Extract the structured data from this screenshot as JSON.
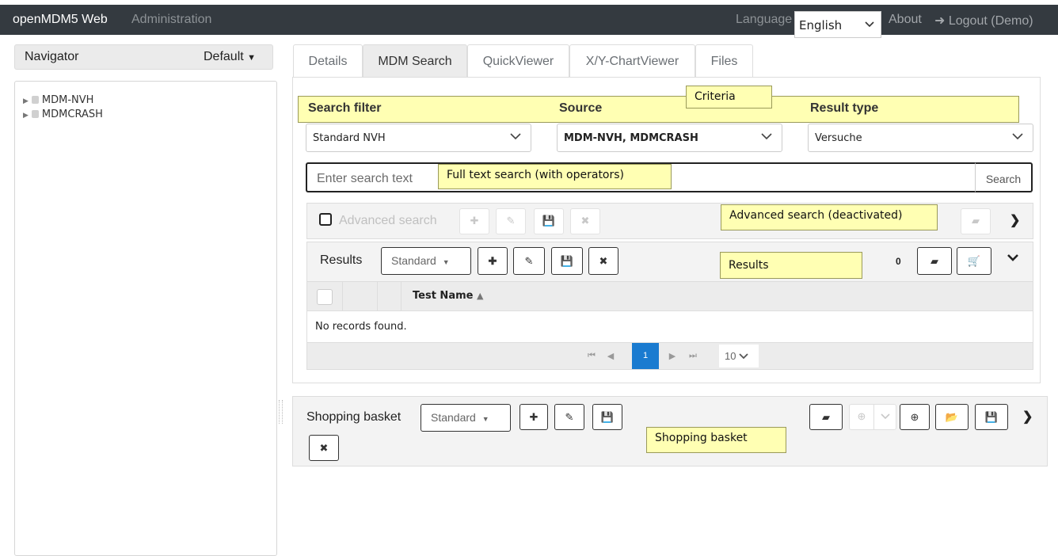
{
  "header": {
    "brand": "openMDM5 Web",
    "admin_link": "Administration",
    "language_label": "Language",
    "language_value": "English",
    "about": "About",
    "logout": "Logout (Demo)"
  },
  "navigator": {
    "title": "Navigator",
    "view_selector": "Default",
    "tree": [
      {
        "label": "MDM-NVH"
      },
      {
        "label": "MDMCRASH"
      }
    ]
  },
  "tabs": [
    {
      "label": "Details",
      "active": false
    },
    {
      "label": "MDM Search",
      "active": true
    },
    {
      "label": "QuickViewer",
      "active": false
    },
    {
      "label": "X/Y-ChartViewer",
      "active": false
    },
    {
      "label": "Files",
      "active": false
    }
  ],
  "criteria": {
    "search_filter_label": "Search filter",
    "source_label": "Source",
    "result_type_label": "Result type",
    "search_filter_value": "Standard NVH",
    "source_value": "MDM-NVH, MDMCRASH",
    "result_type_value": "Versuche"
  },
  "search": {
    "placeholder": "Enter search text",
    "button": "Search"
  },
  "advanced": {
    "label": "Advanced search",
    "enabled": false
  },
  "results": {
    "label": "Results",
    "view_selector": "Standard",
    "count": "0",
    "columns": [
      "Test Name"
    ],
    "empty_message": "No records found.",
    "pager": {
      "current_page": "1",
      "rows_per_page": "10"
    }
  },
  "basket": {
    "label": "Shopping basket",
    "view_selector": "Standard"
  },
  "annotations": {
    "criteria": "Criteria",
    "full_text": "Full text search (with operators)",
    "advanced": "Advanced search (deactivated)",
    "results": "Results",
    "basket": "Shopping basket"
  },
  "colors": {
    "navbar": "#343a40",
    "annotation_fill": "#ffffb3",
    "pager_active": "#1a7bd0"
  }
}
